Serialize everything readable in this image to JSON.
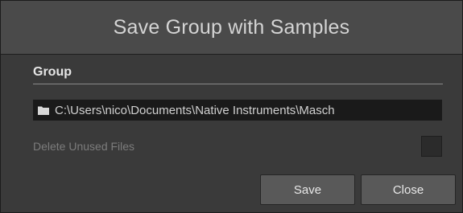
{
  "dialog": {
    "title": "Save Group with Samples"
  },
  "group_section": {
    "label": "Group",
    "path_value": "C:\\Users\\nico\\Documents\\Native Instruments\\Masch",
    "path_icon": "folder-icon"
  },
  "options": {
    "delete_unused_label": "Delete Unused Files",
    "delete_unused_checked": false
  },
  "buttons": {
    "save_label": "Save",
    "close_label": "Close"
  },
  "colors": {
    "dialog_background": "#3a3a3a",
    "titlebar_background": "#4a4a4a",
    "path_field_background": "#1a1a1a",
    "button_background": "#595959"
  }
}
